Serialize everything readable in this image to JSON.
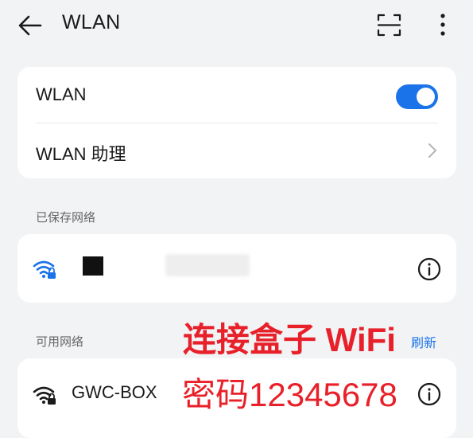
{
  "header": {
    "title": "WLAN",
    "back_icon": "arrow-left-icon",
    "scan_icon": "scan-icon",
    "more_icon": "more-vertical-icon"
  },
  "wlan_card": {
    "toggle_label": "WLAN",
    "toggle_on": true,
    "assistant_label": "WLAN 助理"
  },
  "saved": {
    "section_label": "已保存网络",
    "network_name": ""
  },
  "available": {
    "section_label": "可用网络",
    "refresh_label": "刷新",
    "networks": [
      {
        "name": "GWC-BOX",
        "secured": true
      }
    ]
  },
  "overlay": {
    "line1": "连接盒子 WiFi",
    "line2": "密码12345678"
  },
  "colors": {
    "accent": "#1a73e8",
    "overlay_red": "#e8202a",
    "background": "#f1f3f5",
    "card": "#ffffff"
  }
}
